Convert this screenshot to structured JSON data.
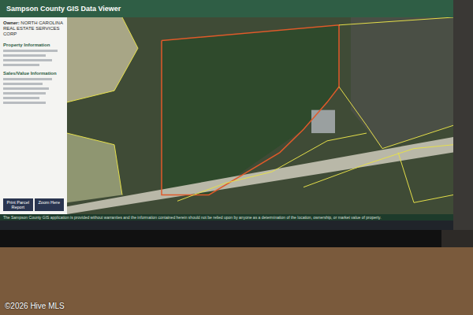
{
  "window": {
    "title": "Sampson County GIS Data Viewer"
  },
  "panel": {
    "owner_label": "Owner:",
    "owner": "NORTH CAROLINA REAL ESTATE SERVICES CORP",
    "sections": [
      "Property Information",
      "Sales/Value Information"
    ],
    "buttons": [
      "Print Parcel Report",
      "Zoom Here"
    ]
  },
  "disclaimer": "The Sampson County GIS application is provided without warranties and the information contained herein should not be relied upon by anyone as a determination of the location, ownership, or market value of property.",
  "watermark": "©2026 Hive MLS"
}
